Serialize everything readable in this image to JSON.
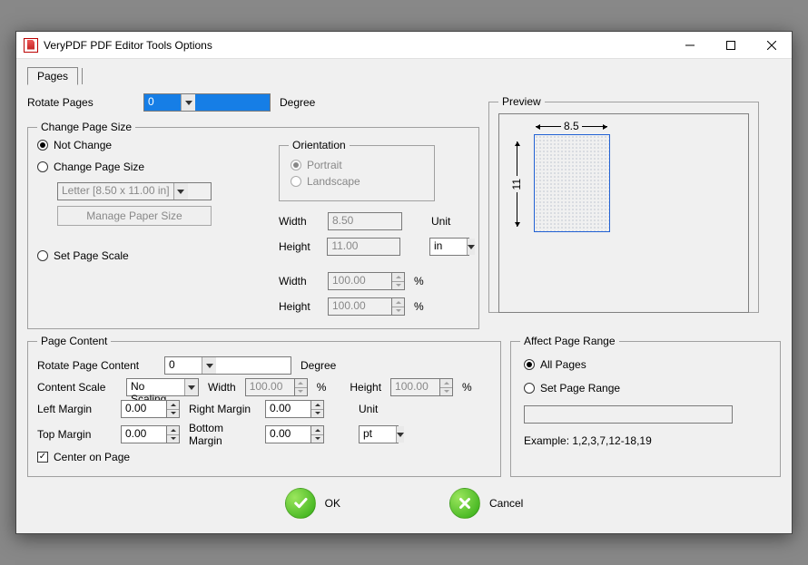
{
  "window": {
    "title": "VeryPDF PDF Editor Tools Options"
  },
  "tabs": {
    "pages": "Pages"
  },
  "rotate": {
    "label": "Rotate Pages",
    "value": "0",
    "degree": "Degree"
  },
  "change_size": {
    "legend": "Change Page Size",
    "not_change": "Not Change",
    "change": "Change Page Size",
    "paper": "Letter [8.50 x 11.00 in]",
    "manage": "Manage Paper Size",
    "set_scale": "Set Page Scale",
    "orientation": {
      "legend": "Orientation",
      "portrait": "Portrait",
      "landscape": "Landscape"
    },
    "width_lbl": "Width",
    "height_lbl": "Height",
    "width": "8.50",
    "height": "11.00",
    "unit_lbl": "Unit",
    "unit": "in",
    "scale_w": "100.00",
    "scale_h": "100.00",
    "pct": "%"
  },
  "preview": {
    "legend": "Preview",
    "w": "8.5",
    "h": "11"
  },
  "content": {
    "legend": "Page Content",
    "rotate_lbl": "Rotate Page Content",
    "rotate": "0",
    "degree": "Degree",
    "scale_lbl": "Content Scale",
    "scale": "No Scaling",
    "width_lbl": "Width",
    "width": "100.00",
    "height_lbl": "Height",
    "height": "100.00",
    "pct": "%",
    "lm_lbl": "Left Margin",
    "lm": "0.00",
    "rm_lbl": "Right Margin",
    "rm": "0.00",
    "tm_lbl": "Top Margin",
    "tm": "0.00",
    "bm_lbl": "Bottom Margin",
    "bm": "0.00",
    "unit_lbl": "Unit",
    "unit": "pt",
    "center": "Center on Page"
  },
  "range": {
    "legend": "Affect Page Range",
    "all": "All Pages",
    "set": "Set Page Range",
    "example": "Example: 1,2,3,7,12-18,19"
  },
  "footer": {
    "ok": "OK",
    "cancel": "Cancel"
  }
}
